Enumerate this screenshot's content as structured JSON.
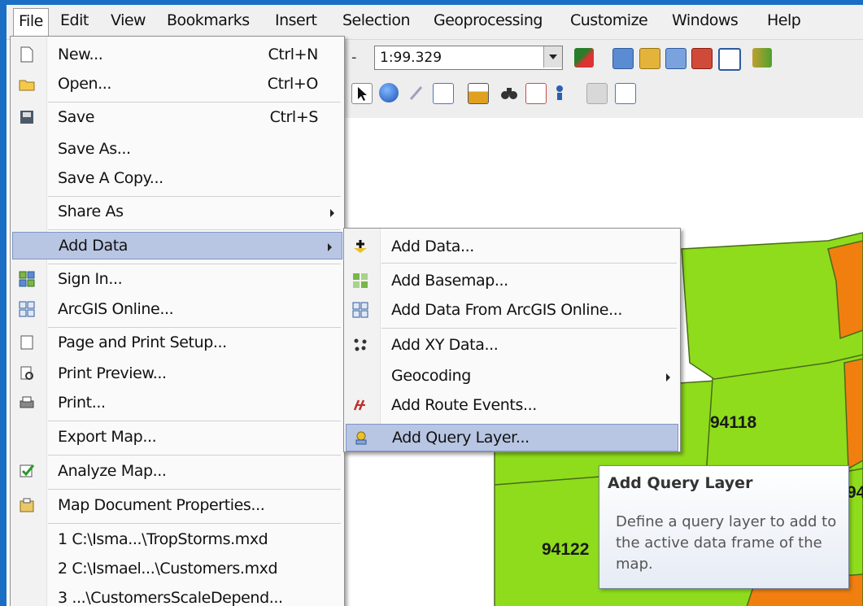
{
  "menubar": {
    "items": [
      "File",
      "Edit",
      "View",
      "Bookmarks",
      "Insert",
      "Selection",
      "Geoprocessing",
      "Customize",
      "Windows",
      "Help"
    ]
  },
  "toolbar": {
    "scale_value": "1:99.329",
    "scale_arrow_left": "-"
  },
  "file_menu": {
    "items": [
      {
        "label": "New...",
        "shortcut": "Ctrl+N",
        "icon": "new-document-icon"
      },
      {
        "label": "Open...",
        "shortcut": "Ctrl+O",
        "icon": "open-folder-icon"
      },
      {
        "label": "Save",
        "shortcut": "Ctrl+S",
        "icon": "save-disk-icon"
      },
      {
        "label": "Save As..."
      },
      {
        "label": "Save A Copy..."
      },
      {
        "label": "Share As",
        "submenu": true
      },
      {
        "label": "Add Data",
        "submenu": true,
        "highlighted": true
      },
      {
        "label": "Sign In...",
        "icon": "sign-in-grid-icon"
      },
      {
        "label": "ArcGIS Online...",
        "icon": "arcgis-online-grid-icon"
      },
      {
        "label": "Page and Print Setup...",
        "icon": "page-setup-icon"
      },
      {
        "label": "Print Preview...",
        "icon": "print-preview-icon"
      },
      {
        "label": "Print...",
        "icon": "printer-icon"
      },
      {
        "label": "Export Map..."
      },
      {
        "label": "Analyze Map...",
        "icon": "analyze-map-icon"
      },
      {
        "label": "Map Document Properties...",
        "icon": "properties-icon"
      },
      {
        "label": "1 C:\\Isma...\\TropStorms.mxd"
      },
      {
        "label": "2 C:\\Ismael...\\Customers.mxd"
      },
      {
        "label": "3 ...\\CustomersScaleDepend..."
      }
    ]
  },
  "add_data_submenu": {
    "items": [
      {
        "label": "Add Data...",
        "icon": "add-data-plus-icon"
      },
      {
        "label": "Add Basemap...",
        "icon": "basemap-grid-icon"
      },
      {
        "label": "Add Data From ArcGIS Online...",
        "icon": "arcgis-online-grid-icon"
      },
      {
        "label": "Add XY Data...",
        "icon": "xy-data-icon"
      },
      {
        "label": "Geocoding",
        "submenu": true
      },
      {
        "label": "Add Route Events...",
        "icon": "route-events-icon"
      },
      {
        "label": "Add Query Layer...",
        "icon": "query-layer-icon",
        "highlighted": true
      }
    ]
  },
  "tooltip": {
    "title": "Add Query Layer",
    "description": "Define a query layer to add to the active data frame of the map."
  },
  "map": {
    "labels": [
      "94118",
      "94122",
      "94"
    ],
    "colors": {
      "green": "#8edc1c",
      "orange": "#f07f10",
      "line": "#4a6a1a"
    }
  }
}
